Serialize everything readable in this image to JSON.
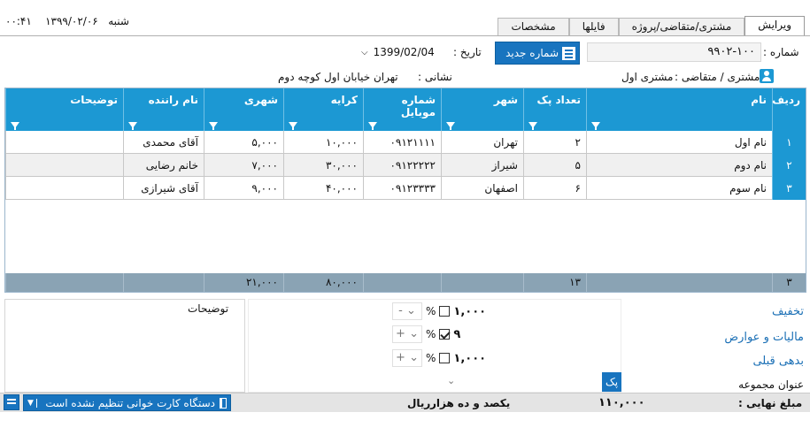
{
  "window": {
    "clock": "۰۰:۴۱",
    "weekday": "شنبه",
    "header_date": "۱۳۹۹/۰۲/۰۶"
  },
  "tabs": [
    {
      "label": "ویرایش",
      "active": true
    },
    {
      "label": "مشتری/متقاضی/پروژه",
      "active": false
    },
    {
      "label": "فایلها",
      "active": false
    },
    {
      "label": "مشخصات",
      "active": false
    }
  ],
  "form": {
    "number_label": "شماره :",
    "number_value": "۹۹۰۲-۱۰۰",
    "new_number_label": "شماره جدید",
    "date_label": "تاریخ :",
    "date_value": "1399/02/04",
    "customer_label": "مشتری / متقاضی :",
    "customer_value": "مشتری اول",
    "address_label": "نشانی :",
    "address_value": "تهران خیابان اول کوچه دوم"
  },
  "grid": {
    "columns": [
      "ردیف",
      "نام",
      "تعداد پک",
      "شهر",
      "شماره موبایل",
      "کرایه",
      "شهری",
      "نام راننده",
      "توضیحات"
    ],
    "rows": [
      {
        "idx": "۱",
        "name": "نام اول",
        "packs": "۲",
        "city": "تهران",
        "mobile": "۰۹۱۲۱۱۱۱",
        "fare": "۱۰,۰۰۰",
        "urban": "۵,۰۰۰",
        "driver": "آقای محمدی",
        "notes": ""
      },
      {
        "idx": "۲",
        "name": "نام دوم",
        "packs": "۵",
        "city": "شیراز",
        "mobile": "۰۹۱۲۲۲۲۲",
        "fare": "۳۰,۰۰۰",
        "urban": "۷,۰۰۰",
        "driver": "خانم رضایی",
        "notes": ""
      },
      {
        "idx": "۳",
        "name": "نام سوم",
        "packs": "۶",
        "city": "اصفهان",
        "mobile": "۰۹۱۲۳۳۳۳",
        "fare": "۴۰,۰۰۰",
        "urban": "۹,۰۰۰",
        "driver": "آقای شیرازی",
        "notes": ""
      }
    ],
    "footer": {
      "idx": "۳",
      "packs": "۱۳",
      "fare": "۸۰,۰۰۰",
      "urban": "۲۱,۰۰۰"
    }
  },
  "adjustments": {
    "discount_label": "تخفیف",
    "tax_label": "مالیات و عوارض",
    "prev_debt_label": "بدهی قبلی",
    "group_title_label": "عنوان مجموعه",
    "rows": [
      {
        "amount": "۱,۰۰۰",
        "checked": false,
        "percent": "%",
        "op": "-"
      },
      {
        "amount": "۹",
        "checked": true,
        "percent": "%",
        "op": "+"
      },
      {
        "amount": "۱,۰۰۰",
        "checked": false,
        "percent": "%",
        "op": "+"
      }
    ],
    "pk_label": "پک"
  },
  "notes_label": "توضیحات",
  "totals": {
    "final_label": "مبلغ نهایی :",
    "final_value": "۱۱۰,۰۰۰",
    "words": "یکصد و ده هزار",
    "currency": "ریال"
  },
  "card_reader": {
    "label": "دستگاه کارت خوانی تنظیم نشده است"
  },
  "colors": {
    "header_blue": "#1c98d3",
    "button_blue": "#1874bf",
    "footer_gray": "#8aa3b4"
  }
}
